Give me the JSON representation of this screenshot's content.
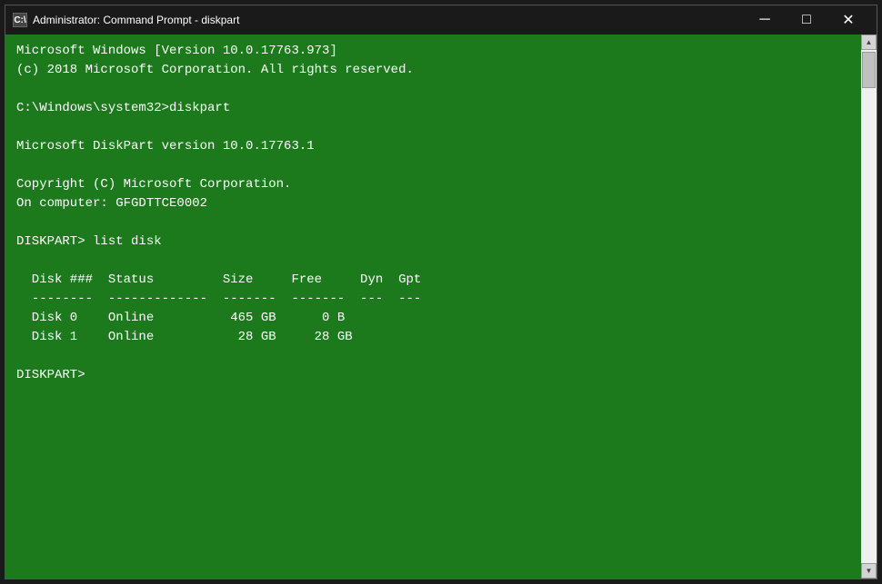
{
  "window": {
    "title": "Administrator: Command Prompt - diskpart",
    "icon_label": "C:\\",
    "min_button": "─",
    "max_button": "□",
    "close_button": "✕"
  },
  "terminal": {
    "lines": [
      "Microsoft Windows [Version 10.0.17763.973]",
      "(c) 2018 Microsoft Corporation. All rights reserved.",
      "",
      "C:\\Windows\\system32>diskpart",
      "",
      "Microsoft DiskPart version 10.0.17763.1",
      "",
      "Copyright (C) Microsoft Corporation.",
      "On computer: GFGDTTCE0002",
      "",
      "DISKPART> list disk",
      "",
      "  Disk ###  Status         Size     Free     Dyn  Gpt",
      "  --------  -------------  -------  -------  ---  ---",
      "  Disk 0    Online          465 GB      0 B",
      "  Disk 1    Online           28 GB     28 GB",
      "",
      "DISKPART> "
    ]
  }
}
